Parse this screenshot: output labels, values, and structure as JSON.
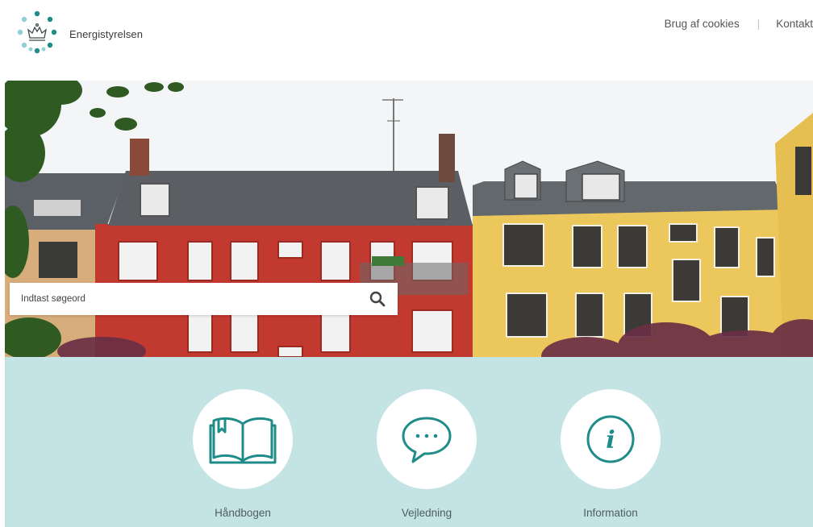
{
  "header": {
    "logo_text": "Energistyrelsen",
    "links": [
      {
        "label": "Brug af cookies"
      },
      {
        "label": "Kontakt"
      }
    ]
  },
  "search": {
    "placeholder": "Indtast søgeord",
    "icon": "search-icon"
  },
  "tiles": [
    {
      "label": "Håndbogen",
      "icon": "open-book-icon"
    },
    {
      "label": "Vejledning",
      "icon": "speech-bubble-icon"
    },
    {
      "label": "Information",
      "icon": "info-icon"
    }
  ],
  "colors": {
    "accent": "#1f8c8a",
    "tile_band": "#c4e3e4",
    "logo_dot_dark": "#1f8c8a",
    "logo_dot_light": "#8fcfd6"
  }
}
